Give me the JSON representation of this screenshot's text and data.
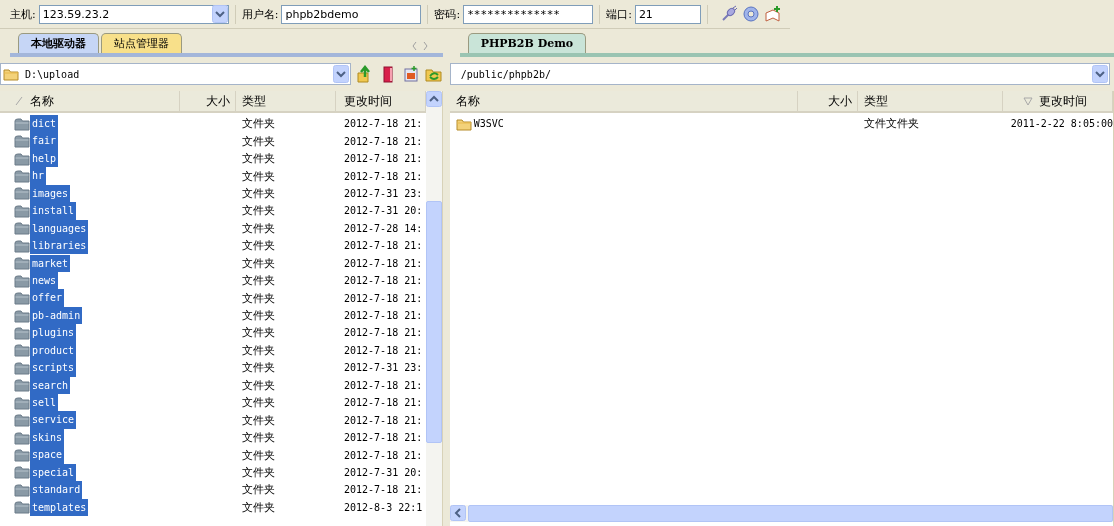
{
  "toolbar": {
    "host": {
      "label": "主机:",
      "value": "123.59.23.2"
    },
    "username": {
      "label": "用户名:",
      "value": "phpb2bdemo"
    },
    "password": {
      "label": "密码:",
      "value": "**************"
    },
    "port": {
      "label": "端口:",
      "value": "21"
    }
  },
  "local": {
    "tabs": [
      {
        "label": "本地驱动器",
        "selected": true
      },
      {
        "label": "站点管理器",
        "selected": false
      }
    ],
    "path": "D:\\upload",
    "columns": [
      "名称",
      "大小",
      "类型",
      "更改时间"
    ],
    "rows": [
      {
        "name": "dict",
        "type": "文件夹",
        "modified": "2012-7-18 21:",
        "selected": true
      },
      {
        "name": "fair",
        "type": "文件夹",
        "modified": "2012-7-18 21:",
        "selected": true
      },
      {
        "name": "help",
        "type": "文件夹",
        "modified": "2012-7-18 21:",
        "selected": true
      },
      {
        "name": "hr",
        "type": "文件夹",
        "modified": "2012-7-18 21:",
        "selected": true
      },
      {
        "name": "images",
        "type": "文件夹",
        "modified": "2012-7-31 23:",
        "selected": true
      },
      {
        "name": "install",
        "type": "文件夹",
        "modified": "2012-7-31 20:",
        "selected": true
      },
      {
        "name": "languages",
        "type": "文件夹",
        "modified": "2012-7-28 14:",
        "selected": true
      },
      {
        "name": "libraries",
        "type": "文件夹",
        "modified": "2012-7-18 21:",
        "selected": true
      },
      {
        "name": "market",
        "type": "文件夹",
        "modified": "2012-7-18 21:",
        "selected": true
      },
      {
        "name": "news",
        "type": "文件夹",
        "modified": "2012-7-18 21:",
        "selected": true
      },
      {
        "name": "offer",
        "type": "文件夹",
        "modified": "2012-7-18 21:",
        "selected": true
      },
      {
        "name": "pb-admin",
        "type": "文件夹",
        "modified": "2012-7-18 21:",
        "selected": true
      },
      {
        "name": "plugins",
        "type": "文件夹",
        "modified": "2012-7-18 21:",
        "selected": true
      },
      {
        "name": "product",
        "type": "文件夹",
        "modified": "2012-7-18 21:",
        "selected": true
      },
      {
        "name": "scripts",
        "type": "文件夹",
        "modified": "2012-7-31 23:",
        "selected": true
      },
      {
        "name": "search",
        "type": "文件夹",
        "modified": "2012-7-18 21:",
        "selected": true
      },
      {
        "name": "sell",
        "type": "文件夹",
        "modified": "2012-7-18 21:",
        "selected": true
      },
      {
        "name": "service",
        "type": "文件夹",
        "modified": "2012-7-18 21:",
        "selected": true
      },
      {
        "name": "skins",
        "type": "文件夹",
        "modified": "2012-7-18 21:",
        "selected": true
      },
      {
        "name": "space",
        "type": "文件夹",
        "modified": "2012-7-18 21:",
        "selected": true
      },
      {
        "name": "special",
        "type": "文件夹",
        "modified": "2012-7-31 20:",
        "selected": true
      },
      {
        "name": "standard",
        "type": "文件夹",
        "modified": "2012-7-18 21:",
        "selected": true
      },
      {
        "name": "templates",
        "type": "文件夹",
        "modified": "2012-8-3 22:1",
        "selected": true
      }
    ]
  },
  "remote": {
    "tabs": [
      {
        "label": "PHPB2B Demo",
        "selected": true
      }
    ],
    "path": "/public/phpb2b/",
    "columns": [
      "名称",
      "大小",
      "类型",
      "更改时间"
    ],
    "rows": [
      {
        "name": "W3SVC",
        "type": "文件文件夹",
        "modified": "2011-2-22 8:05:00",
        "selected": false
      }
    ]
  }
}
